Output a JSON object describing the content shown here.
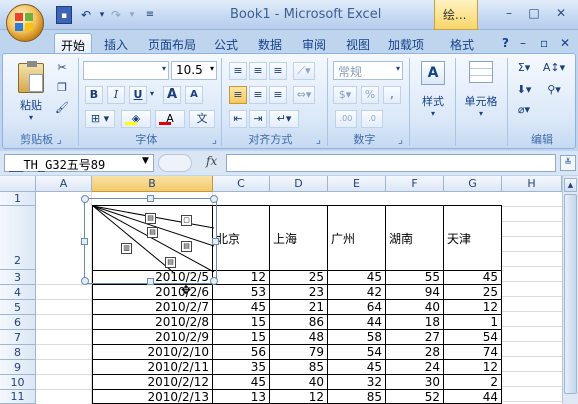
{
  "window": {
    "title": "Book1 - Microsoft Excel",
    "addin_tab": "绘..."
  },
  "tabs": [
    "开始",
    "插入",
    "页面布局",
    "公式",
    "数据",
    "审阅",
    "视图",
    "加载项",
    "格式"
  ],
  "ribbon": {
    "clipboard": {
      "paste": "粘贴",
      "label": "剪贴板"
    },
    "font": {
      "size": "10.5",
      "bold": "B",
      "italic": "I",
      "underline": "U",
      "grow": "A",
      "shrink": "A",
      "color_char": "A",
      "phonetic": "文",
      "label": "字体"
    },
    "alignment": {
      "label": "对齐方式"
    },
    "number": {
      "format": "常规",
      "percent": "%",
      "comma": ",",
      "label": "数字"
    },
    "styles": {
      "label": "样式"
    },
    "cells": {
      "label": "单元格"
    },
    "editing": {
      "label": "编辑"
    }
  },
  "formula_bar": {
    "name_box": "__TH_G32五号89",
    "fx": "fx",
    "value": ""
  },
  "columns": [
    "A",
    "B",
    "C",
    "D",
    "E",
    "F",
    "G",
    "H"
  ],
  "rows": [
    "1",
    "2",
    "3",
    "4",
    "5",
    "6",
    "7",
    "8",
    "9",
    "10",
    "11"
  ],
  "headers": [
    "北京",
    "上海",
    "广州",
    "湖南",
    "天津"
  ],
  "data": [
    {
      "date": "2010/2/5",
      "v": [
        "12",
        "25",
        "45",
        "55",
        "45"
      ]
    },
    {
      "date": "2010/2/6",
      "v": [
        "53",
        "23",
        "42",
        "94",
        "25"
      ]
    },
    {
      "date": "2010/2/7",
      "v": [
        "45",
        "21",
        "64",
        "40",
        "12"
      ]
    },
    {
      "date": "2010/2/8",
      "v": [
        "15",
        "86",
        "44",
        "18",
        "1"
      ]
    },
    {
      "date": "2010/2/9",
      "v": [
        "15",
        "48",
        "58",
        "27",
        "54"
      ]
    },
    {
      "date": "2010/2/10",
      "v": [
        "56",
        "79",
        "54",
        "28",
        "74"
      ]
    },
    {
      "date": "2010/2/11",
      "v": [
        "35",
        "85",
        "45",
        "24",
        "12"
      ]
    },
    {
      "date": "2010/2/12",
      "v": [
        "45",
        "40",
        "32",
        "30",
        "2"
      ]
    },
    {
      "date": "2010/2/13",
      "v": [
        "13",
        "12",
        "85",
        "52",
        "44"
      ]
    }
  ]
}
